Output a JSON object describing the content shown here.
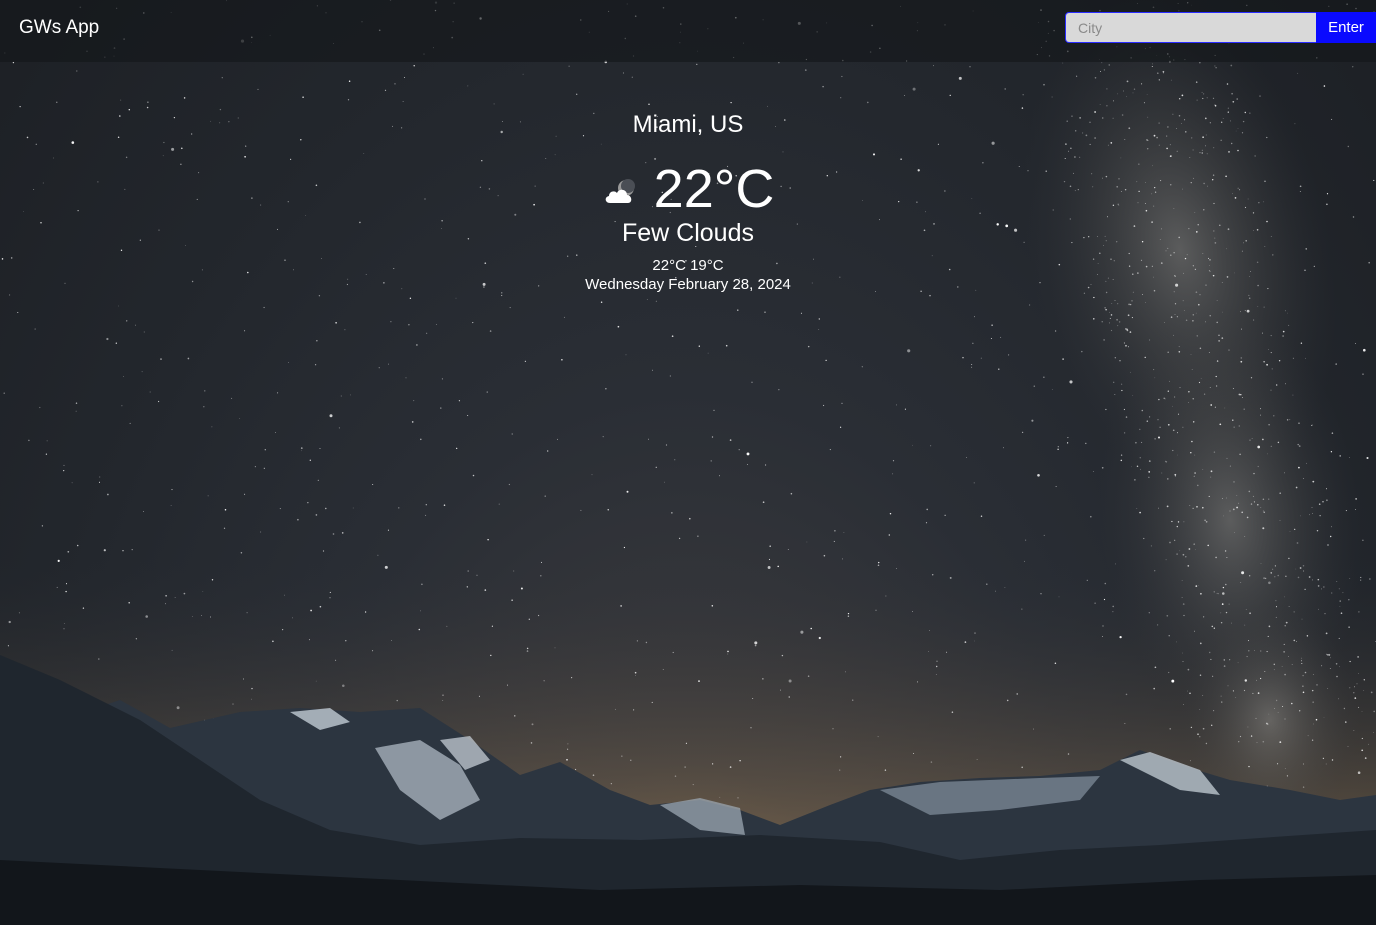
{
  "app": {
    "brand": "GWs App"
  },
  "search": {
    "placeholder": "City",
    "value": "",
    "button_label": "Enter"
  },
  "weather": {
    "location": "Miami, US",
    "icon": "few-clouds-night-icon",
    "temperature": "22°C",
    "condition": "Few Clouds",
    "minmax": "22°C 19°C",
    "date": "Wednesday February 28, 2024"
  },
  "colors": {
    "button_bg": "#0a0aff",
    "input_bg": "#d9d9d9",
    "navbar_bg": "rgba(20,22,26,0.62)",
    "text": "#ffffff"
  },
  "background": {
    "scene": "night-sky-milky-way-over-mountains"
  }
}
